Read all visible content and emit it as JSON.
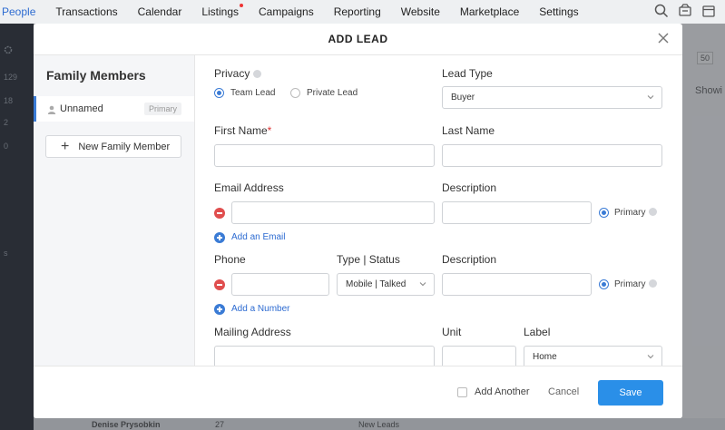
{
  "topnav": {
    "items": [
      "People",
      "Transactions",
      "Calendar",
      "Listings",
      "Campaigns",
      "Reporting",
      "Website",
      "Marketplace",
      "Settings"
    ]
  },
  "sidebar_bg": {
    "counts": [
      "129",
      "18",
      "2",
      "0"
    ],
    "s_letter": "s"
  },
  "right_bg": {
    "per_page": "50",
    "showing": "Showi"
  },
  "bottom_peek": {
    "name": "Denise Prysobkin",
    "count": "27",
    "status": "New Leads"
  },
  "modal": {
    "title": "ADD LEAD",
    "left": {
      "title": "Family Members",
      "member": {
        "name": "Unnamed",
        "badge": "Primary"
      },
      "new_member_label": "New Family Member"
    },
    "form": {
      "privacy": {
        "label": "Privacy",
        "options": [
          "Team Lead",
          "Private Lead"
        ],
        "selected": "Team Lead"
      },
      "lead_type": {
        "label": "Lead Type",
        "value": "Buyer"
      },
      "first_name": {
        "label": "First Name",
        "required_mark": "*",
        "value": ""
      },
      "last_name": {
        "label": "Last Name",
        "value": ""
      },
      "email": {
        "label": "Email Address",
        "value": "",
        "description_label": "Description",
        "description": "",
        "primary_label": "Primary",
        "add_link": "Add an Email"
      },
      "phone": {
        "label": "Phone",
        "value": "",
        "type_status_label": "Type | Status",
        "type_status_value": "Mobile | Talked",
        "description_label": "Description",
        "description": "",
        "primary_label": "Primary",
        "add_link": "Add a Number"
      },
      "mailing": {
        "label": "Mailing Address",
        "value": "",
        "unit_label": "Unit",
        "unit": "",
        "label_label": "Label",
        "label_value": "Home"
      }
    },
    "footer": {
      "add_another": "Add Another",
      "cancel": "Cancel",
      "save": "Save"
    }
  }
}
